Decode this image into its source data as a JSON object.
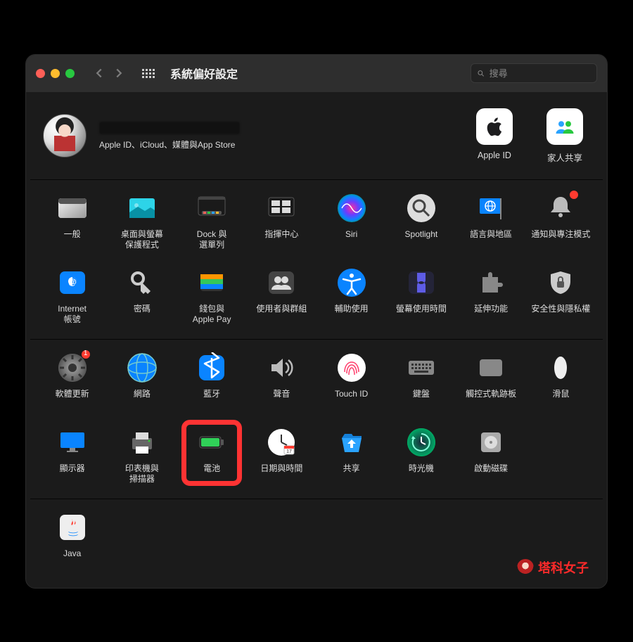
{
  "window": {
    "title": "系統偏好設定",
    "search_placeholder": "搜尋"
  },
  "user": {
    "subtext": "Apple ID、iCloud、媒體與App Store"
  },
  "header_items": [
    {
      "id": "apple-id",
      "label": "Apple ID"
    },
    {
      "id": "family",
      "label": "家人共享"
    }
  ],
  "rows": {
    "row1": [
      {
        "id": "general",
        "label": "一般"
      },
      {
        "id": "desktop",
        "label": "桌面與螢幕\n保護程式"
      },
      {
        "id": "dock",
        "label": "Dock 與\n選單列"
      },
      {
        "id": "mission",
        "label": "指揮中心"
      },
      {
        "id": "siri",
        "label": "Siri"
      },
      {
        "id": "spotlight",
        "label": "Spotlight"
      },
      {
        "id": "language",
        "label": "語言與地區"
      },
      {
        "id": "notifications",
        "label": "通知與專注模式",
        "badge": ""
      }
    ],
    "row2": [
      {
        "id": "internet",
        "label": "Internet\n帳號"
      },
      {
        "id": "passwords",
        "label": "密碼"
      },
      {
        "id": "wallet",
        "label": "錢包與\nApple Pay"
      },
      {
        "id": "users",
        "label": "使用者與群組"
      },
      {
        "id": "accessibility",
        "label": "輔助使用"
      },
      {
        "id": "screentime",
        "label": "螢幕使用時間"
      },
      {
        "id": "extensions",
        "label": "延伸功能"
      },
      {
        "id": "security",
        "label": "安全性與隱私權"
      }
    ],
    "row3": [
      {
        "id": "update",
        "label": "軟體更新",
        "badge": "1"
      },
      {
        "id": "network",
        "label": "網路"
      },
      {
        "id": "bluetooth",
        "label": "藍牙"
      },
      {
        "id": "sound",
        "label": "聲音"
      },
      {
        "id": "touchid",
        "label": "Touch ID"
      },
      {
        "id": "keyboard",
        "label": "鍵盤"
      },
      {
        "id": "trackpad",
        "label": "觸控式軌跡板"
      },
      {
        "id": "mouse",
        "label": "滑鼠"
      }
    ],
    "row4": [
      {
        "id": "displays",
        "label": "顯示器"
      },
      {
        "id": "printers",
        "label": "印表機與\n掃描器"
      },
      {
        "id": "battery",
        "label": "電池",
        "highlight": true
      },
      {
        "id": "datetime",
        "label": "日期與時間"
      },
      {
        "id": "sharing",
        "label": "共享"
      },
      {
        "id": "timemachine",
        "label": "時光機"
      },
      {
        "id": "startup",
        "label": "啟動磁碟"
      }
    ],
    "row5": [
      {
        "id": "java",
        "label": "Java"
      }
    ]
  },
  "watermark": "塔科女子"
}
